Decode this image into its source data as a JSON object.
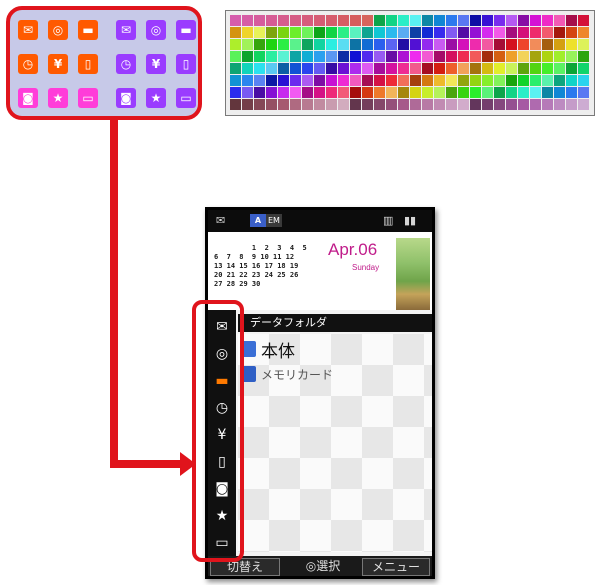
{
  "palette_icons": [
    {
      "name": "mail-icon",
      "glyph": "✉",
      "color": "orange"
    },
    {
      "name": "disc-icon",
      "glyph": "◎",
      "color": "orange"
    },
    {
      "name": "folder-icon",
      "glyph": "▬",
      "color": "orange"
    },
    {
      "name": "mail-icon-alt",
      "glyph": "✉",
      "color": "violet"
    },
    {
      "name": "disc-icon-alt",
      "glyph": "◎",
      "color": "violet"
    },
    {
      "name": "folder-icon-alt",
      "glyph": "▬",
      "color": "violet"
    },
    {
      "name": "clock-icon",
      "glyph": "◷",
      "color": "orange"
    },
    {
      "name": "tools-icon",
      "glyph": "¥",
      "color": "orange"
    },
    {
      "name": "book-icon",
      "glyph": "▯",
      "color": "orange"
    },
    {
      "name": "clock-icon-alt",
      "glyph": "◷",
      "color": "violet"
    },
    {
      "name": "tools-icon-alt",
      "glyph": "¥",
      "color": "violet"
    },
    {
      "name": "book-icon-alt",
      "glyph": "▯",
      "color": "violet"
    },
    {
      "name": "camera-icon",
      "glyph": "◙",
      "color": "magenta"
    },
    {
      "name": "star-icon",
      "glyph": "★",
      "color": "magenta"
    },
    {
      "name": "display-icon",
      "glyph": "▭",
      "color": "magenta"
    },
    {
      "name": "camera-icon-alt",
      "glyph": "◙",
      "color": "violet"
    },
    {
      "name": "star-icon-alt",
      "glyph": "★",
      "color": "violet"
    },
    {
      "name": "display-icon-alt",
      "glyph": "▭",
      "color": "violet"
    }
  ],
  "accent": "#e0141c",
  "status_bar": {
    "em_badge": "A",
    "em_text": "EM"
  },
  "calendar": {
    "rows": [
      "         1  2  3  4  5",
      "6  7  8  9 10 11 12",
      "13 14 15 16 17 18 19",
      "20 21 22 23 24 25 26",
      "27 28 29 30"
    ],
    "date": "Apr.06",
    "weekday": "Sunday"
  },
  "folder_header": "データフォルダ",
  "folders": [
    {
      "label": "本体"
    },
    {
      "label": "メモリカード"
    }
  ],
  "side_icons": [
    "mail-icon",
    "disc-icon",
    "folder-icon",
    "clock-icon",
    "tools-icon",
    "book-icon",
    "camera-icon",
    "star-icon",
    "display-icon"
  ],
  "softkeys": {
    "left": "切替え",
    "center": "◎選択",
    "right": "メニュー"
  }
}
